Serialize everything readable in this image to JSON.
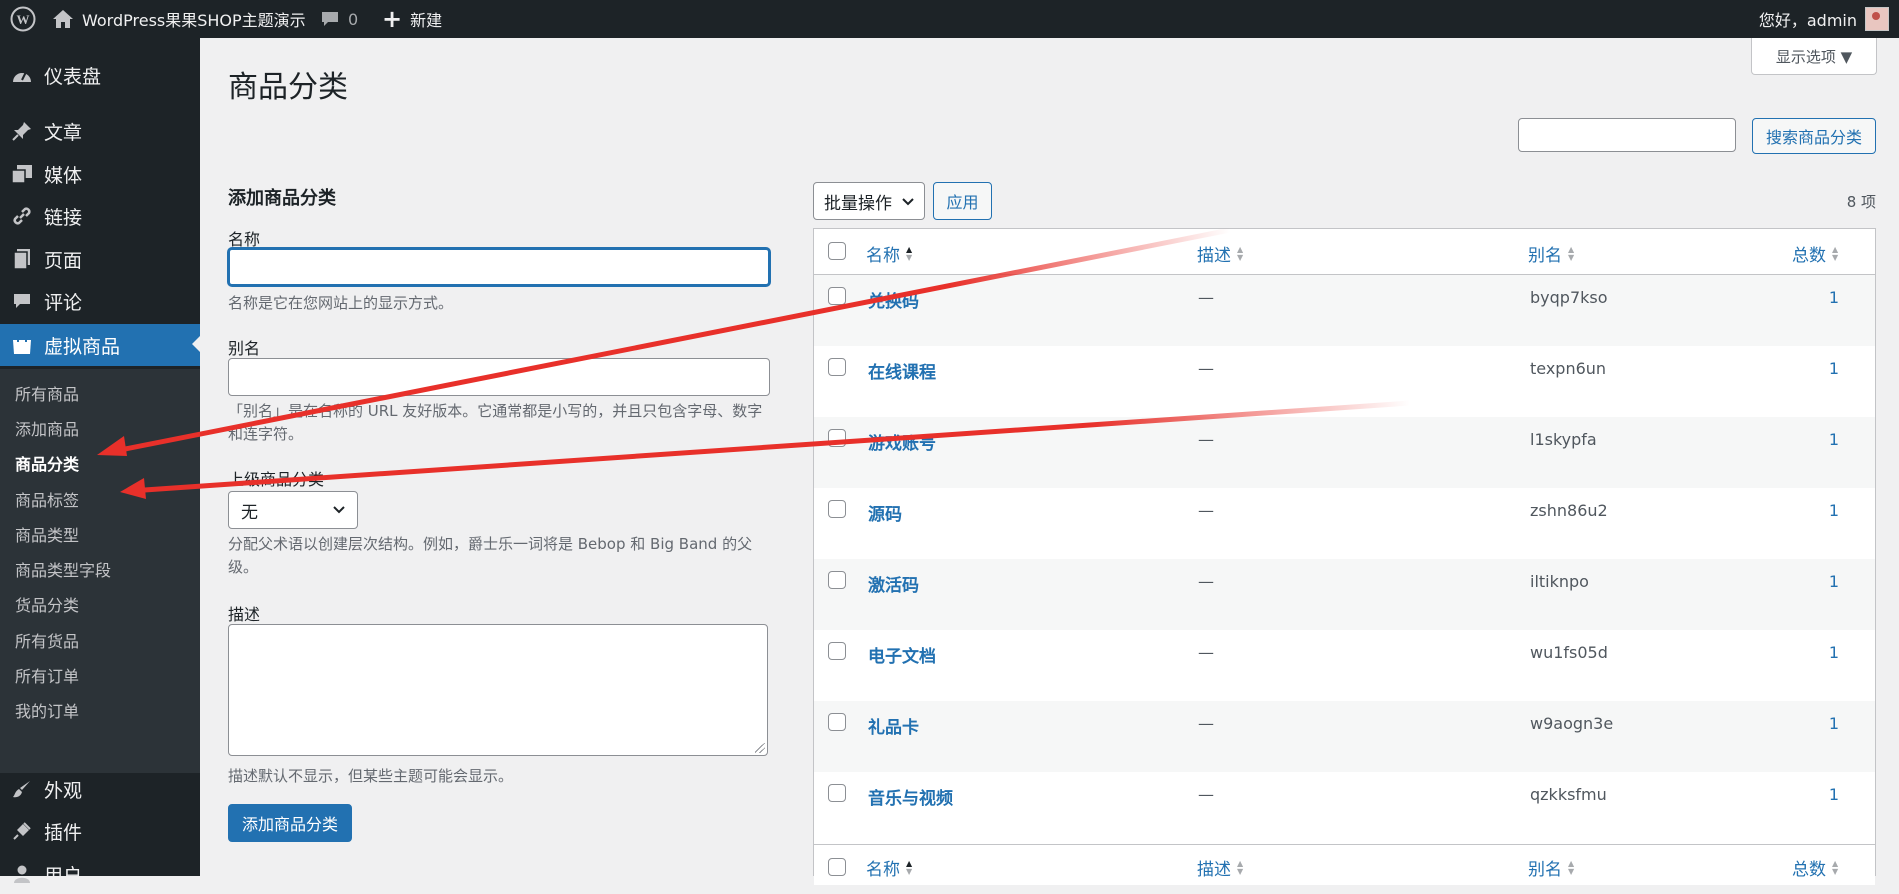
{
  "admin_bar": {
    "site_name": "WordPress果果SHOP主题演示",
    "comments_count": "0",
    "new_label": "新建",
    "greeting": "您好，admin"
  },
  "sidebar": {
    "items": [
      {
        "label": "仪表盘",
        "icon": "dashboard-icon"
      },
      {
        "label": "文章",
        "icon": "pin-icon"
      },
      {
        "label": "媒体",
        "icon": "media-icon"
      },
      {
        "label": "链接",
        "icon": "link-icon"
      },
      {
        "label": "页面",
        "icon": "page-icon"
      },
      {
        "label": "评论",
        "icon": "comment-icon"
      },
      {
        "label": "虚拟商品",
        "icon": "shop-icon"
      }
    ],
    "submenu": [
      "所有商品",
      "添加商品",
      "商品分类",
      "商品标签",
      "商品类型",
      "商品类型字段",
      "货品分类",
      "所有货品",
      "所有订单",
      "我的订单"
    ],
    "bottom_items": [
      {
        "label": "外观",
        "icon": "brush-icon"
      },
      {
        "label": "插件",
        "icon": "plugin-icon"
      },
      {
        "label": "用户",
        "icon": "user-icon"
      }
    ]
  },
  "page": {
    "title": "商品分类",
    "screen_options": "显示选项 ▼",
    "search_button": "搜索商品分类"
  },
  "form": {
    "heading": "添加商品分类",
    "name_label": "名称",
    "name_help": "名称是它在您网站上的显示方式。",
    "slug_label": "别名",
    "slug_help": "「别名」是在名称的 URL 友好版本。它通常都是小写的，并且只包含字母、数字和连字符。",
    "parent_label": "上级商品分类",
    "parent_value": "无",
    "parent_help": "分配父术语以创建层次结构。例如，爵士乐一词将是 Bebop 和 Big Band 的父级。",
    "desc_label": "描述",
    "desc_help": "描述默认不显示，但某些主题可能会显示。",
    "submit": "添加商品分类"
  },
  "table": {
    "bulk_action": "批量操作",
    "apply": "应用",
    "count": "8 项",
    "headers": {
      "name": "名称",
      "desc": "描述",
      "slug": "别名",
      "count": "总数"
    },
    "rows": [
      {
        "name": "兑换码",
        "desc": "—",
        "slug": "byqp7kso",
        "count": "1"
      },
      {
        "name": "在线课程",
        "desc": "—",
        "slug": "texpn6un",
        "count": "1"
      },
      {
        "name": "游戏账号",
        "desc": "—",
        "slug": "l1skypfa",
        "count": "1"
      },
      {
        "name": "源码",
        "desc": "—",
        "slug": "zshn86u2",
        "count": "1"
      },
      {
        "name": "激活码",
        "desc": "—",
        "slug": "iltiknpo",
        "count": "1"
      },
      {
        "name": "电子文档",
        "desc": "—",
        "slug": "wu1fs05d",
        "count": "1"
      },
      {
        "name": "礼品卡",
        "desc": "—",
        "slug": "w9aogn3e",
        "count": "1"
      },
      {
        "name": "音乐与视频",
        "desc": "—",
        "slug": "qzkksfmu",
        "count": "1"
      }
    ]
  },
  "colors": {
    "accent": "#2271b1",
    "admin_dark": "#1d2327",
    "annotation_arrow": "#e8302a"
  }
}
